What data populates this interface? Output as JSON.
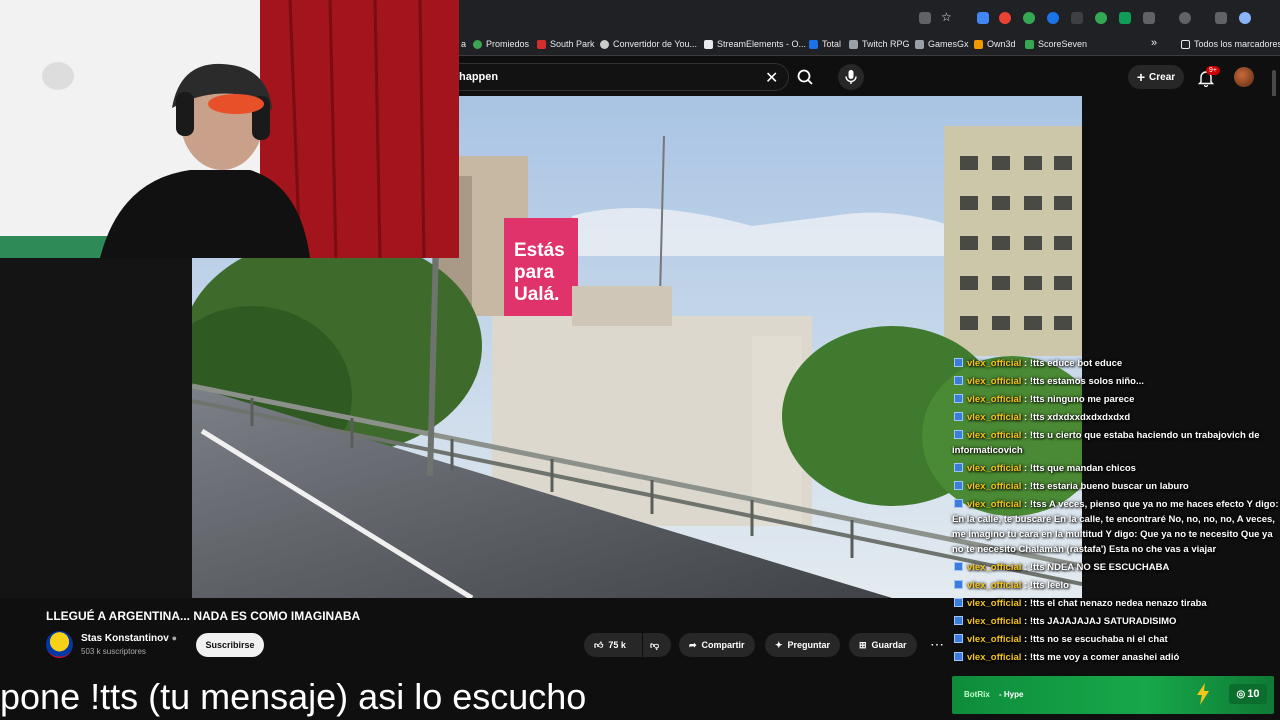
{
  "bookmarks": [
    {
      "label": "Promiedos",
      "color": "#3aa655"
    },
    {
      "label": "South Park",
      "color": "#d32f2f"
    },
    {
      "label": "Convertidor de You...",
      "color": "#cccccc"
    },
    {
      "label": "StreamElements - O...",
      "color": "#e8eaed"
    },
    {
      "label": "Total",
      "color": "#1a73e8"
    },
    {
      "label": "Twitch RPG",
      "color": "#9aa0a6"
    },
    {
      "label": "GamesGx",
      "color": "#9aa0a6"
    },
    {
      "label": "Own3d",
      "color": "#f29900"
    },
    {
      "label": "ScoreSeven",
      "color": "#34a853"
    }
  ],
  "bookmarks_more": "»",
  "bookmarks_folder": "Todos los marcadores",
  "search": {
    "value": "happen"
  },
  "header": {
    "create_label": "Crear",
    "notif_badge": "9+"
  },
  "video": {
    "title": "LLEGUÉ A ARGENTINA... NADA ES COMO IMAGINABA",
    "channel": "Stas Konstantinov",
    "subscribers": "503 k suscriptores",
    "subscribe_label": "Suscribirse",
    "likes": "75 k",
    "share_label": "Compartir",
    "ask_label": "Preguntar",
    "save_label": "Guardar",
    "billboard_line1": "Estás",
    "billboard_line2": "para",
    "billboard_line3": "Ualá."
  },
  "chat": [
    {
      "user": "vlex_official",
      "text": "!tts educe bot educe"
    },
    {
      "user": "vlex_official",
      "text": "!tts estamos solos niño..."
    },
    {
      "user": "vlex_official",
      "text": "!tts ninguno me parece"
    },
    {
      "user": "vlex_official",
      "text": "!tts xdxdxxdxdxdxdxd"
    },
    {
      "user": "vlex_official",
      "text": "!tts u cierto que estaba haciendo un trabajovich de informaticovich"
    },
    {
      "user": "vlex_official",
      "text": "!tts que mandan chicos"
    },
    {
      "user": "vlex_official",
      "text": "!tts estaria bueno buscar un laburo"
    },
    {
      "user": "vlex_official",
      "text": "!tss A veces, pienso que ya no me haces efecto Y digo: En la calle, te buscaré En la calle, te encontraré No, no, no, no, A veces, me imagino tu cara en la multitud Y digo: Que ya no te necesito Que ya no te necesito Chalamán (rastafa') Esta no che vas a viajar"
    },
    {
      "user": "vlex_official",
      "text": "!tts NDEA NO SE ESCUCHABA"
    },
    {
      "user": "vlex_official",
      "text": "!tts leelo"
    },
    {
      "user": "vlex_official",
      "text": "!tts el chat nenazo nedea nenazo tiraba"
    },
    {
      "user": "vlex_official",
      "text": "!tts JAJAJAJAJ SATURADISIMO"
    },
    {
      "user": "vlex_official",
      "text": "!tts no se escuchaba ni el chat"
    },
    {
      "user": "vlex_official",
      "text": "!tts me voy a comer anashei adió"
    }
  ],
  "overlay_subtitle": "pone !tts (tu mensaje) asi lo escucho",
  "botrix": {
    "name": "BotRix",
    "label": "- Hype",
    "count": "10"
  },
  "colors": {
    "accent_green": "#17a84a",
    "chat_user": "#f5c518",
    "badge_red": "#cc0000"
  }
}
